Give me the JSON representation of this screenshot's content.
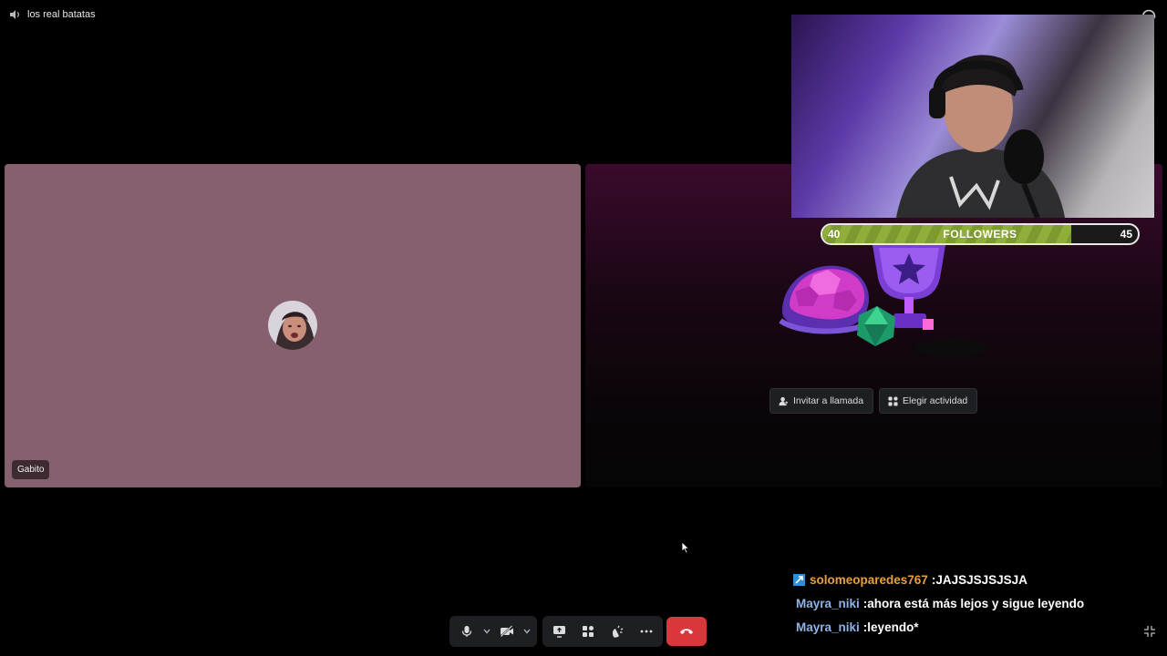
{
  "window": {
    "channel_name": "los real batatas",
    "channel_icon": "speaker-icon"
  },
  "participant": {
    "name": "Gabito",
    "tile_color": "#86606e"
  },
  "activity_panel": {
    "invite_button": "Invitar a llamada",
    "activity_button": "Elegir actividad"
  },
  "stream_overlay": {
    "followers_current": "40",
    "followers_label": "FOLLOWERS",
    "followers_goal": "45",
    "progress_fraction": 0.79,
    "progress_color": "#8fae3a"
  },
  "chat": [
    {
      "user": "solomeoparedes767",
      "sep": " :",
      "text": " JAJSJSJSJSJA",
      "user_color": "#e8a13a",
      "badge": true
    },
    {
      "user": "Mayra_niki",
      "sep": " :",
      "text": " ahora está más lejos y sigue leyendo",
      "user_color": "#8fb3e6",
      "badge": false
    },
    {
      "user": "Mayra_niki",
      "sep": " :",
      "text": " leyendo*",
      "user_color": "#8fb3e6",
      "badge": false
    }
  ],
  "controls": {
    "mic": "microphone-icon",
    "camera": "camera-off-icon",
    "share": "screen-share-icon",
    "activities": "activities-icon",
    "soundboard": "soundboard-icon",
    "more": "more-icon",
    "leave": "disconnect-icon",
    "leave_color": "#da373c"
  }
}
